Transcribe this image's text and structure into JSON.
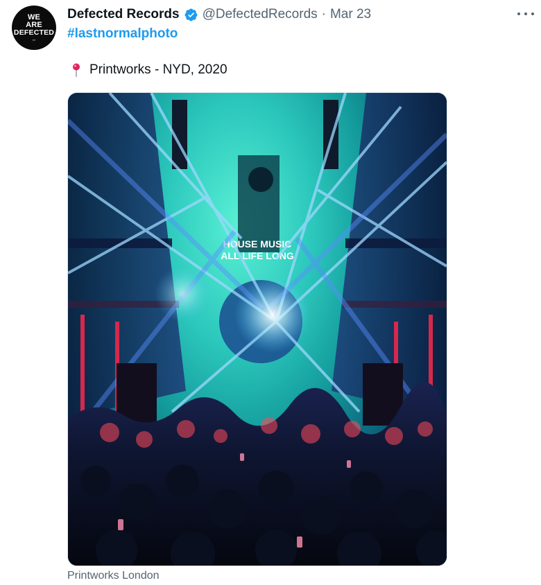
{
  "tweet": {
    "avatar_lines": [
      "WE",
      "ARE",
      "DEFECTED"
    ],
    "display_name": "Defected Records",
    "handle": "@DefectedRecords",
    "separator": "·",
    "date": "Mar 23",
    "hashtag": "#lastnormalphoto",
    "location_text": "Printworks - NYD, 2020",
    "media_caption": "Printworks London",
    "screen_text_1": "HOUSE MUSIC",
    "screen_text_2": "ALL LIFE LONG"
  },
  "colors": {
    "link": "#1d9bf0",
    "verified": "#1d9bf0",
    "secondary_text": "#536471",
    "pin": "#e0245e"
  },
  "icons": {
    "verified": "verified-badge-icon",
    "more": "more-options-icon",
    "location": "round-pushpin-icon"
  }
}
